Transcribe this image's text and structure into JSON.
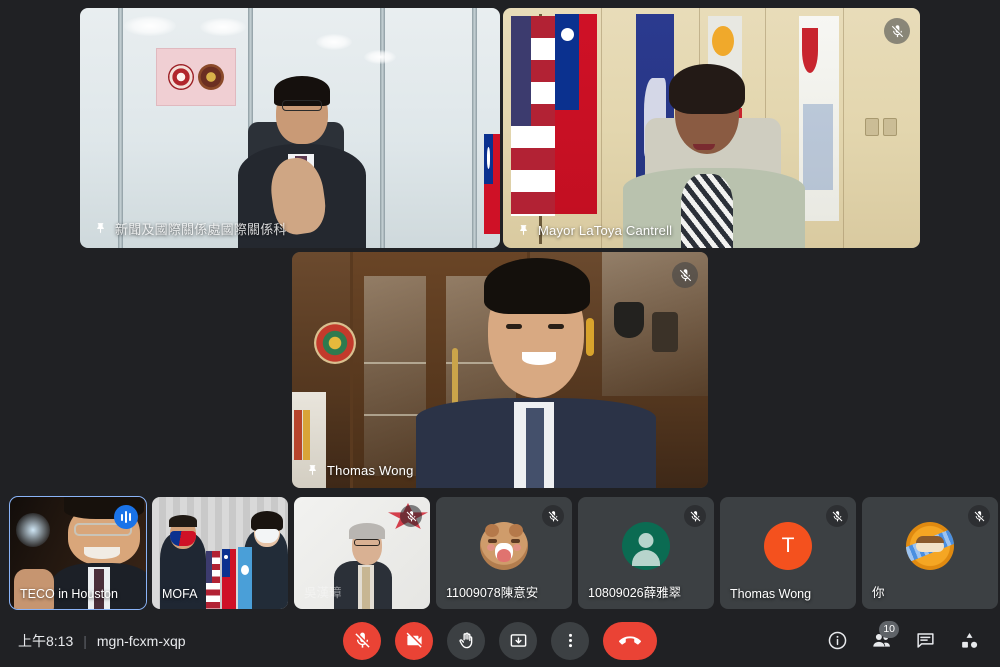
{
  "meta": {
    "time": "上午8:13",
    "separator": "|",
    "meeting_code": "mgn-fcxm-xqp"
  },
  "colors": {
    "app_bg": "#202124",
    "tile_bg": "#3c4043",
    "accent_blue": "#1a73e8",
    "active_border": "#8ab4f8",
    "danger_red": "#ea4335",
    "avatar_orange": "#f4511e",
    "avatar_green": "#0b6b52"
  },
  "stage": {
    "tiles": [
      {
        "name": "新聞及國際關係處國際關係科",
        "pin_icon": "pin-icon",
        "muted": false,
        "mic_icon": "mic-off-icon"
      },
      {
        "name": "Mayor LaToya Cantrell",
        "pin_icon": "pin-icon",
        "muted": true,
        "mic_icon": "mic-off-icon"
      },
      {
        "name": "Thomas Wong",
        "pin_icon": "pin-icon",
        "muted": true,
        "mic_icon": "mic-off-icon"
      }
    ]
  },
  "filmstrip": {
    "tiles": [
      {
        "name": "TECO in Houston",
        "type": "video",
        "active_speaker": true,
        "speaking_icon": "audio-bars-icon",
        "muted": false,
        "mic_icon": "mic-off-icon"
      },
      {
        "name": "MOFA",
        "type": "video",
        "active_speaker": false,
        "muted": false,
        "mic_icon": "mic-off-icon"
      },
      {
        "name": "吳漢璋",
        "type": "video",
        "active_speaker": false,
        "muted": true,
        "mic_icon": "mic-off-icon"
      },
      {
        "name": "11009078陳意安",
        "type": "avatar-photo",
        "avatar_initial": "",
        "active_speaker": false,
        "muted": true,
        "mic_icon": "mic-off-icon"
      },
      {
        "name": "10809026薛雅翠",
        "type": "avatar-silhouette",
        "avatar_initial": "",
        "active_speaker": false,
        "muted": true,
        "mic_icon": "mic-off-icon"
      },
      {
        "name": "Thomas Wong",
        "type": "avatar-initial",
        "avatar_initial": "T",
        "active_speaker": false,
        "muted": true,
        "mic_icon": "mic-off-icon"
      },
      {
        "name": "你",
        "type": "avatar-photo",
        "avatar_initial": "",
        "active_speaker": false,
        "muted": true,
        "mic_icon": "mic-off-icon"
      }
    ]
  },
  "controls": {
    "buttons": [
      {
        "label": "關閉麥克風",
        "icon": "mic-off-icon",
        "state": "off"
      },
      {
        "label": "關閉攝影機",
        "icon": "video-off-icon",
        "state": "off"
      },
      {
        "label": "舉手",
        "icon": "raise-hand-icon",
        "state": "on"
      },
      {
        "label": "立即簡報",
        "icon": "present-screen-icon",
        "state": "on"
      },
      {
        "label": "更多選項",
        "icon": "more-vert-icon",
        "state": "on"
      },
      {
        "label": "離開通話",
        "icon": "end-call-icon",
        "state": "danger"
      }
    ]
  },
  "right_controls": {
    "buttons": [
      {
        "label": "會議詳細資料",
        "icon": "info-icon",
        "badge": ""
      },
      {
        "label": "顯示所有參與者",
        "icon": "people-icon",
        "badge": "10"
      },
      {
        "label": "與所有人進行即時通訊",
        "icon": "chat-icon",
        "badge": ""
      },
      {
        "label": "活動",
        "icon": "activities-icon",
        "badge": ""
      }
    ]
  }
}
